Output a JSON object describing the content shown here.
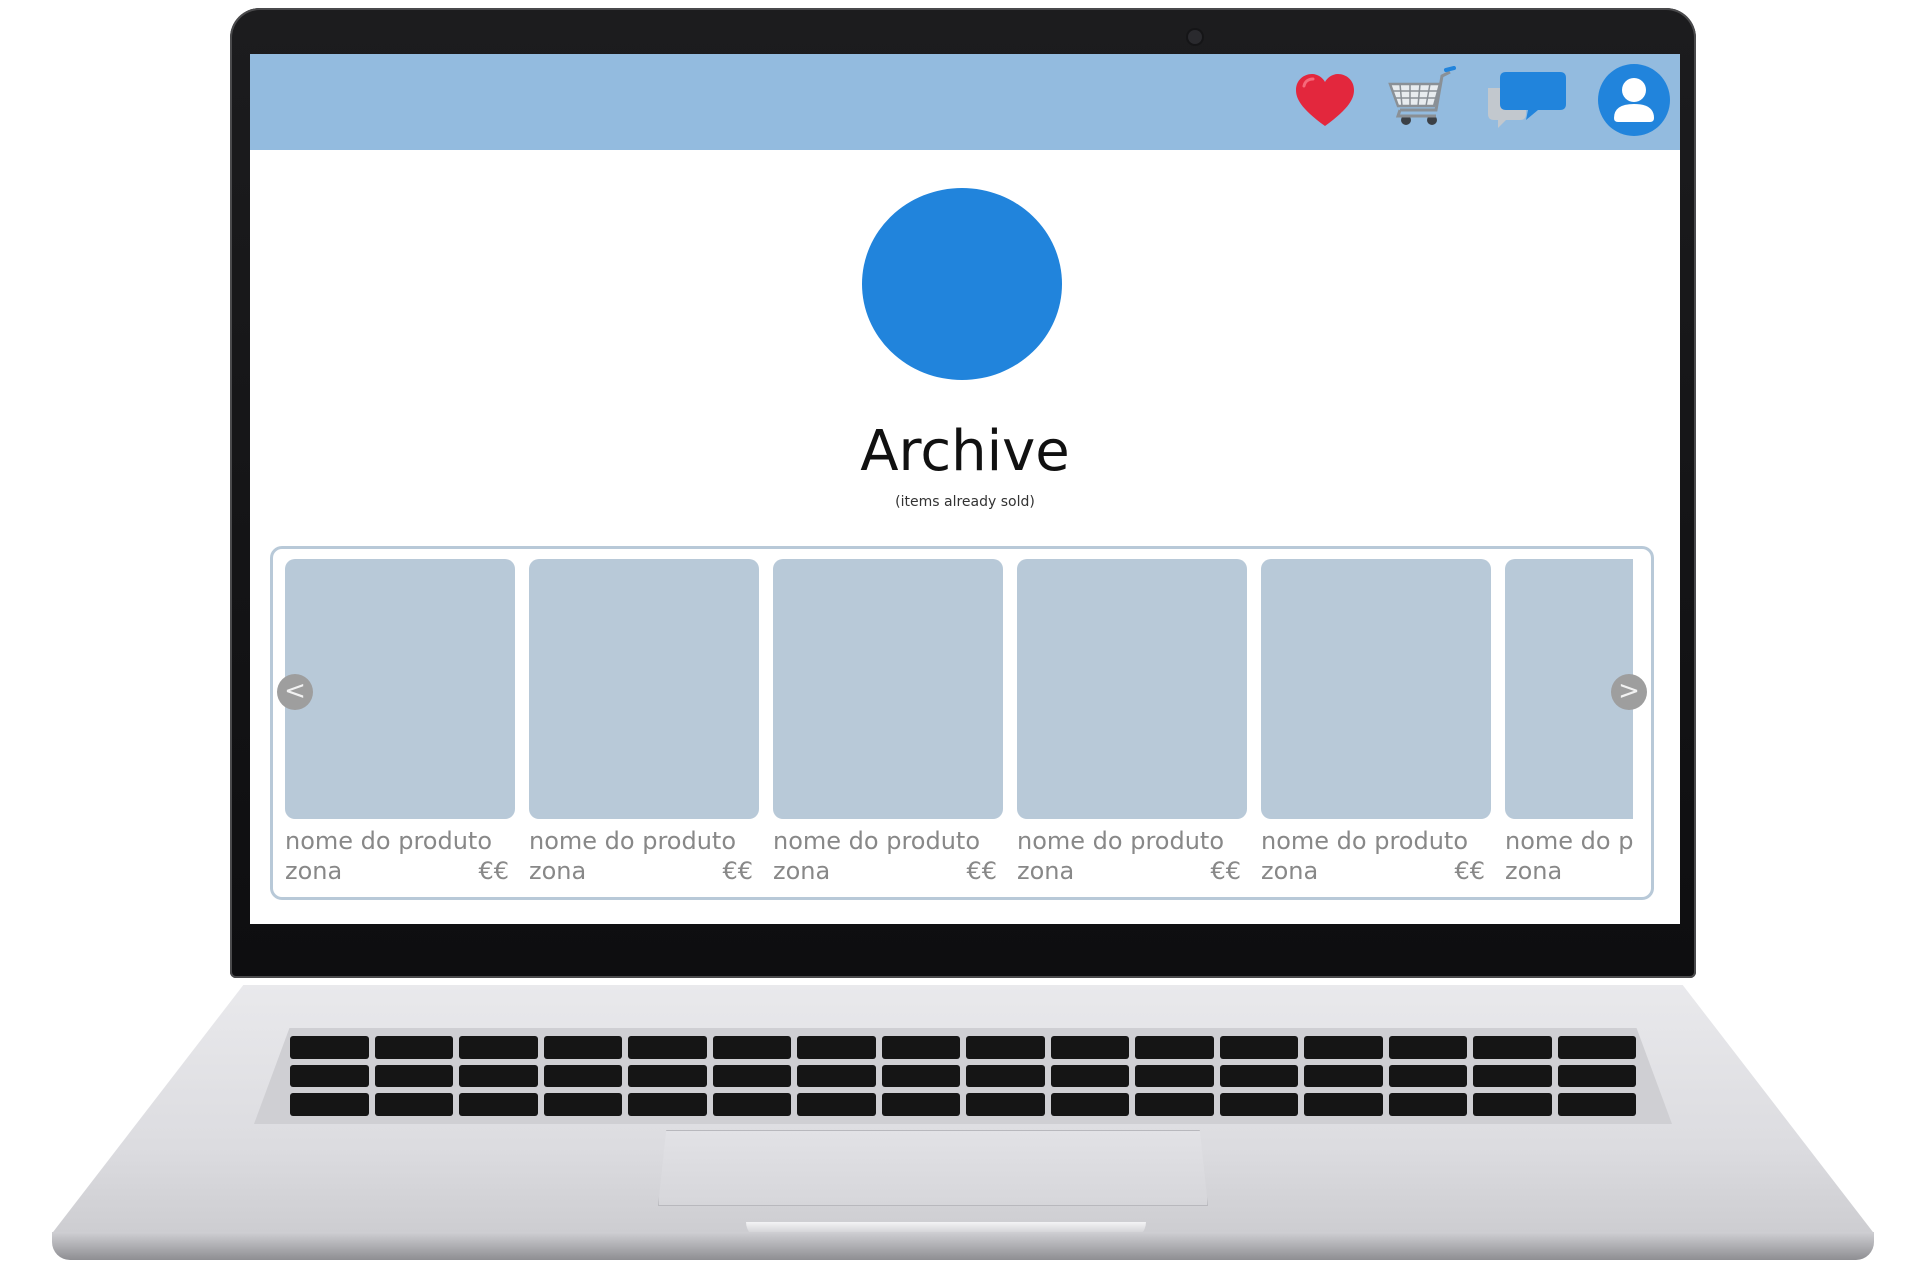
{
  "header": {
    "icons": [
      {
        "name": "heart-icon",
        "color": "#e3273d"
      },
      {
        "name": "shopping-cart-icon",
        "color": "#9aa3aa"
      },
      {
        "name": "chat-icon",
        "color": "#2184dc"
      },
      {
        "name": "user-profile-icon",
        "color": "#2184dc"
      }
    ],
    "background_color": "#93bbdf"
  },
  "profile": {
    "avatar_color": "#2184dc",
    "title": "Archive",
    "subtitle": "(items already sold)"
  },
  "carousel": {
    "prev_label": "<",
    "next_label": ">",
    "items": [
      {
        "name": "nome do produto",
        "zone": "zona",
        "price": "€€"
      },
      {
        "name": "nome do produto",
        "zone": "zona",
        "price": "€€"
      },
      {
        "name": "nome do produto",
        "zone": "zona",
        "price": "€€"
      },
      {
        "name": "nome do produto",
        "zone": "zona",
        "price": "€€"
      },
      {
        "name": "nome do produto",
        "zone": "zona",
        "price": "€€"
      },
      {
        "name": "nome do produto",
        "zone": "zona",
        "price": "€€"
      }
    ]
  }
}
